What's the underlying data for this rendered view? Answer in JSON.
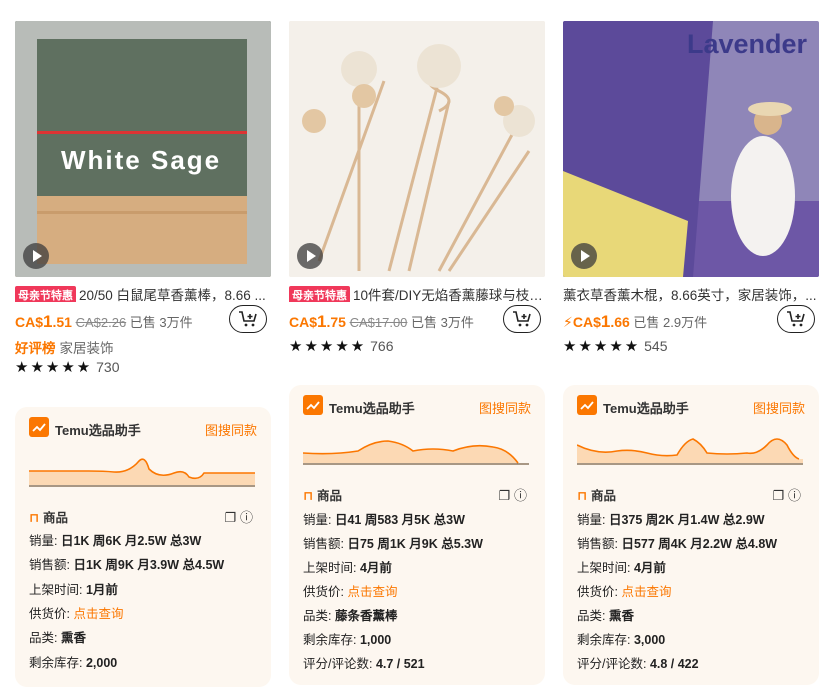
{
  "products": [
    {
      "image_text": "White Sage",
      "badge": "母亲节特惠",
      "title": "20/50 白鼠尾草香薰棒，8.66 ...",
      "price_currency": "CA$",
      "price_int": "1",
      "price_dec": ".51",
      "price_old": "CA$2.26",
      "sold": "已售 3万件",
      "tag_hot": "好评榜",
      "tag": "家居装饰",
      "stars": "★★★★★",
      "reviews": "730"
    },
    {
      "image_text": "",
      "badge": "母亲节特惠",
      "title": "10件套/DIY无焰香薰藤球与枝条...",
      "price_currency": "CA$",
      "price_int": "1",
      "price_dec": ".75",
      "price_old": "CA$17.00",
      "sold": "已售 3万件",
      "stars": "★★★★★",
      "reviews": "766"
    },
    {
      "image_text": "Lavender",
      "title": "薰衣草香薰木棍，8.66英寸，家居装饰，...",
      "price_flash": "⚡",
      "price_currency": "CA$",
      "price_int": "1",
      "price_dec": ".66",
      "sold": "已售 2.9万件",
      "stars": "★★★★★",
      "reviews": "545"
    }
  ],
  "panels": [
    {
      "title": "Temu选品助手",
      "link": "图搜同款",
      "section": "商品",
      "sales_label": "销量:",
      "sales_value": "日1K  周6K  月2.5W  总3W",
      "revenue_label": "销售额:",
      "revenue_value": "日1K  周9K  月3.9W  总4.5W",
      "listed_label": "上架时间:",
      "listed_value": "1月前",
      "supply_label": "供货价:",
      "supply_value": "点击查询",
      "category_label": "品类:",
      "category_value": "熏香",
      "stock_label": "剩余库存:",
      "stock_value": "2,000"
    },
    {
      "title": "Temu选品助手",
      "link": "图搜同款",
      "section": "商品",
      "sales_label": "销量:",
      "sales_value": "日41  周583  月5K  总3W",
      "revenue_label": "销售额:",
      "revenue_value": "日75  周1K  月9K  总5.3W",
      "listed_label": "上架时间:",
      "listed_value": "4月前",
      "supply_label": "供货价:",
      "supply_value": "点击查询",
      "category_label": "品类:",
      "category_value": "藤条香薰棒",
      "stock_label": "剩余库存:",
      "stock_value": "1,000",
      "rating_label": "评分/评论数:",
      "rating_value": "4.7 / 521"
    },
    {
      "title": "Temu选品助手",
      "link": "图搜同款",
      "section": "商品",
      "sales_label": "销量:",
      "sales_value": "日375  周2K  月1.4W  总2.9W",
      "revenue_label": "销售额:",
      "revenue_value": "日577  周4K  月2.2W  总4.8W",
      "listed_label": "上架时间:",
      "listed_value": "4月前",
      "supply_label": "供货价:",
      "supply_value": "点击查询",
      "category_label": "品类:",
      "category_value": "熏香",
      "stock_label": "剩余库存:",
      "stock_value": "3,000",
      "rating_label": "评分/评论数:",
      "rating_value": "4.8 / 422"
    }
  ],
  "colors": {
    "accent": "#fb7701",
    "badge": "#f0385a",
    "panel_bg": "#fdf7f0"
  }
}
